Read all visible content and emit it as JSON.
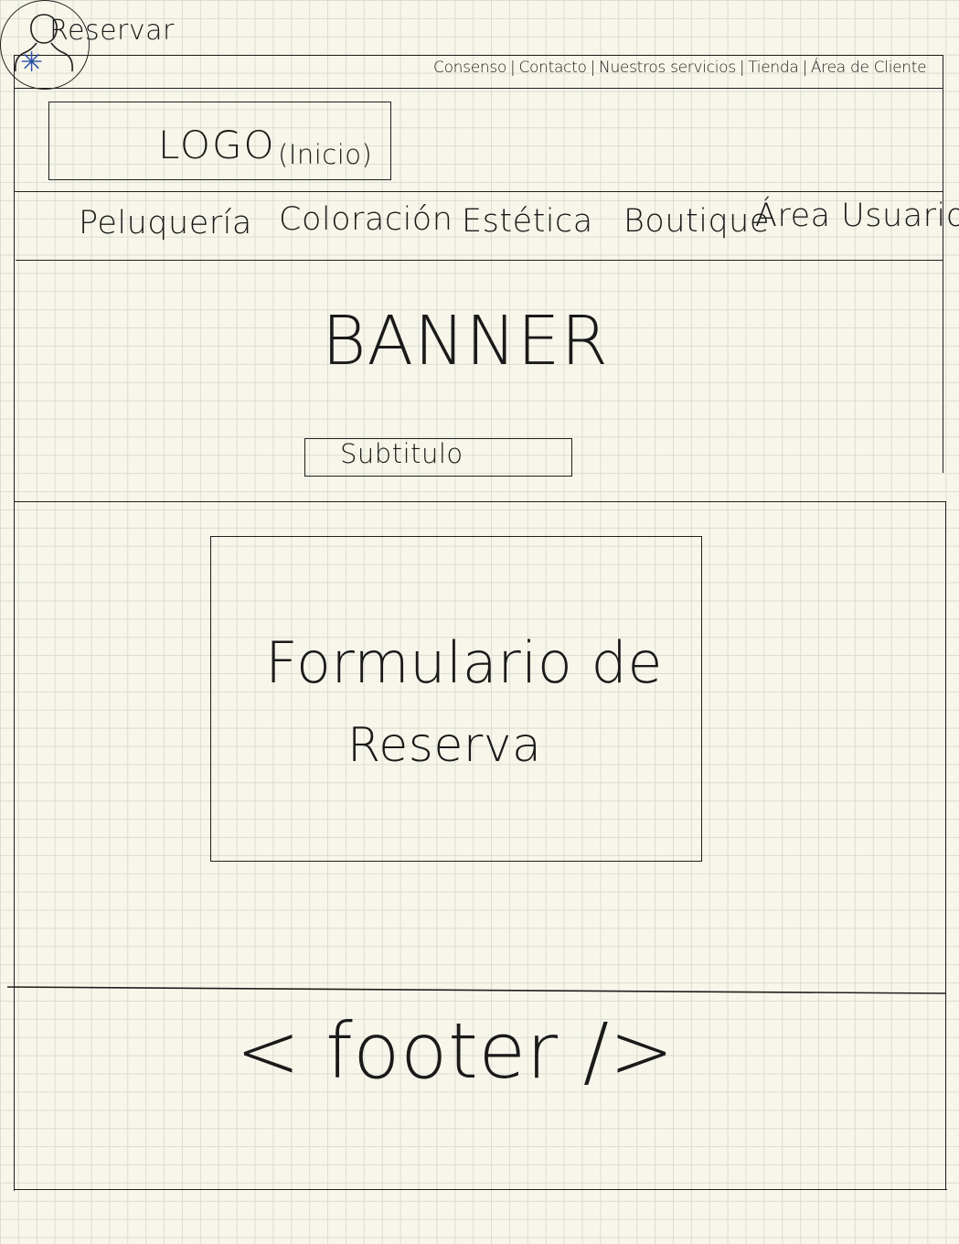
{
  "page": {
    "title": "Reservar"
  },
  "icons": {
    "star": "asterisk-icon",
    "user": "user-avatar-icon"
  },
  "top_nav": {
    "items": [
      "Consenso",
      "Contacto",
      "Nuestros servicios",
      "Tienda",
      "Área de Cliente"
    ],
    "separator": "|"
  },
  "header": {
    "logo": "LOGO",
    "logo_note": "(Inicio)"
  },
  "main_nav": {
    "items": [
      "Peluquería",
      "Coloración",
      "Estética",
      "Boutique",
      "Área Usuario"
    ]
  },
  "banner": {
    "title": "BANNER",
    "subtitle": "Subtitulo"
  },
  "content": {
    "form_line1": "Formulario de",
    "form_line2": "Reserva"
  },
  "footer": {
    "label": "< footer />"
  }
}
